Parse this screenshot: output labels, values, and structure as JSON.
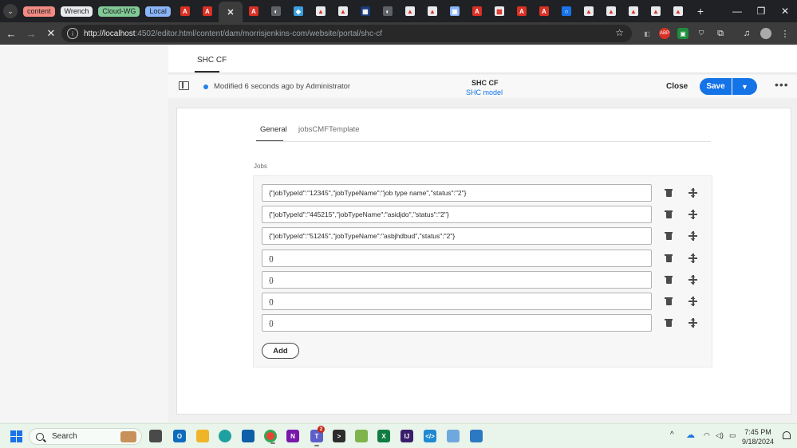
{
  "browser": {
    "tab_groups": [
      {
        "label": "content",
        "color": "#f28b82",
        "text_color": "#202124"
      },
      {
        "label": "Wrench",
        "color": "#e8eaed",
        "text_color": "#202124"
      },
      {
        "label": "Cloud-WG",
        "color": "#81c995",
        "text_color": "#202124"
      },
      {
        "label": "Local",
        "color": "#8ab4f8",
        "text_color": "#202124"
      }
    ],
    "tab_icons": [
      "adobe-icon",
      "adobe-icon",
      "close-icon",
      "adobe-icon",
      "globe-icon",
      "feather-icon",
      "acrobat-icon",
      "acrobat-icon",
      "blue-app-icon",
      "globe-icon",
      "acrobat-icon",
      "acrobat-icon",
      "image-icon",
      "adobe-icon",
      "dark-app-icon",
      "adobe-icon",
      "adobe-icon",
      "circle-icon",
      "acrobat-icon",
      "acrobat-icon",
      "acrobat-icon",
      "acrobat-icon",
      "acrobat-icon"
    ],
    "new_tab": "+",
    "url": "http://localhost:4502/editor.html/content/dam/morrisjenkins-com/website/portal/shc-cf",
    "url_host": "http://localhost",
    "url_rest": ":4502/editor.html/content/dam/morrisjenkins-com/website/portal/shc-cf",
    "extension_label": "ABP"
  },
  "editor": {
    "top_tab": "SHC CF",
    "status_text": "Modified 6 seconds ago by Administrator",
    "doc_title": "SHC CF",
    "doc_model": "SHC model",
    "close_label": "Close",
    "save_label": "Save",
    "more_label": "•••",
    "form_tabs": [
      "General",
      "jobsCMFTemplate"
    ],
    "field_label": "Jobs",
    "rows": [
      "{\"jobTypeId\":\"12345\",\"jobTypeName\":\"job type name\",\"status\":\"2\"}",
      "{\"jobTypeId\":\"445215\",\"jobTypeName\":\"asidjdo\",\"status\":\"2\"}",
      "{\"jobTypeId\":\"51245\",\"jobTypeName\":\"asbjhdbud\",\"status\":\"2\"}",
      "{}",
      "{}",
      "{}",
      "{}"
    ],
    "add_label": "Add",
    "accent_color": "#1473e6"
  },
  "taskbar": {
    "search_label": "Search",
    "teams_badge": "2",
    "time": "7:45 PM",
    "date": "9/18/2024"
  }
}
